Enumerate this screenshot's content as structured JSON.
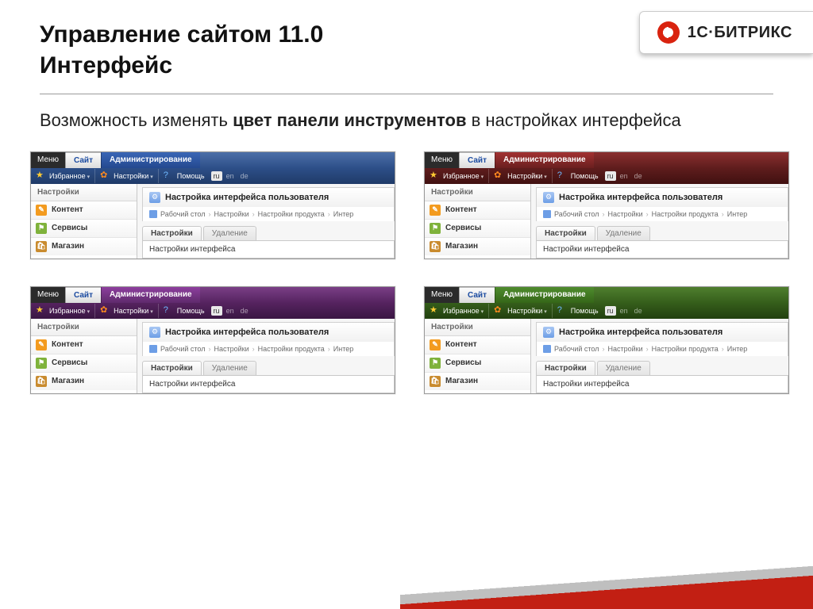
{
  "header": {
    "title_line1": "Управление сайтом 11.0",
    "title_line2": "Интерфейс"
  },
  "logo": {
    "text": "1С·БИТРИКС"
  },
  "description": {
    "pre": "Возможность изменять ",
    "bold": "цвет панели инструментов",
    "post": " в настройках интерфейса"
  },
  "panel": {
    "menu": "Меню",
    "tab_site": "Сайт",
    "tab_admin": "Администрирование",
    "favorites": "Избранное",
    "settings": "Настройки",
    "help": "Помощь",
    "langs": [
      "ru",
      "en",
      "de"
    ],
    "lang_active": "ru",
    "side_head": "Настройки",
    "side_items": [
      {
        "label": "Контент",
        "color": "#f39b1f",
        "glyph": "✎"
      },
      {
        "label": "Сервисы",
        "color": "#7fb23b",
        "glyph": "⚑"
      },
      {
        "label": "Магазин",
        "color": "#c98b2e",
        "glyph": "🛍"
      }
    ],
    "main_title": "Настройка интерфейса пользователя",
    "crumbs": [
      "Рабочий стол",
      "Настройки",
      "Настройки продукта",
      "Интер"
    ],
    "tabs": [
      "Настройки",
      "Удаление"
    ],
    "sub_title": "Настройки интерфейса"
  },
  "themes": [
    "blue",
    "red",
    "purple",
    "green"
  ]
}
